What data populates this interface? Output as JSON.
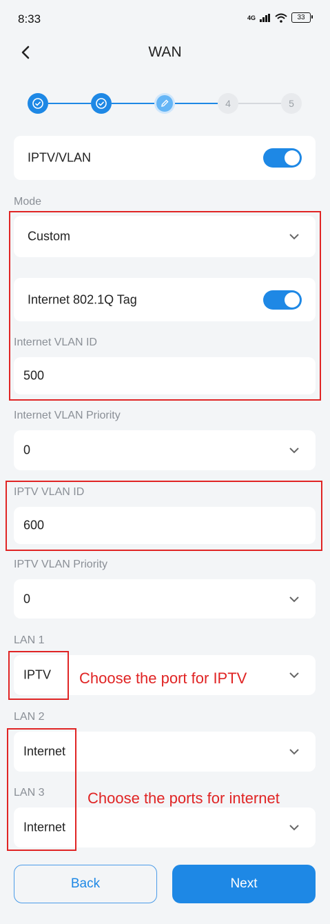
{
  "status_bar": {
    "time": "8:33",
    "network": "4G",
    "battery": "33"
  },
  "header": {
    "title": "WAN"
  },
  "stepper": {
    "steps": [
      "",
      "",
      "",
      "4",
      "5"
    ]
  },
  "iptv_vlan": {
    "label": "IPTV/VLAN",
    "enabled": true
  },
  "mode": {
    "label": "Mode",
    "value": "Custom"
  },
  "internet_tag": {
    "label": "Internet 802.1Q Tag",
    "enabled": true
  },
  "internet_vlan_id": {
    "label": "Internet VLAN ID",
    "value": "500"
  },
  "internet_vlan_priority": {
    "label": "Internet VLAN Priority",
    "value": "0"
  },
  "iptv_vlan_id": {
    "label": "IPTV VLAN ID",
    "value": "600"
  },
  "iptv_vlan_priority": {
    "label": "IPTV VLAN Priority",
    "value": "0"
  },
  "lan1": {
    "label": "LAN 1",
    "value": "IPTV"
  },
  "lan2": {
    "label": "LAN 2",
    "value": "Internet"
  },
  "lan3": {
    "label": "LAN 3",
    "value": "Internet"
  },
  "annotations": {
    "iptv_port": "Choose the port for IPTV",
    "internet_ports": "Choose the ports for internet"
  },
  "buttons": {
    "back": "Back",
    "next": "Next"
  },
  "colors": {
    "accent": "#1e88e5",
    "annotation": "#e02424",
    "background": "#f3f5f7"
  }
}
